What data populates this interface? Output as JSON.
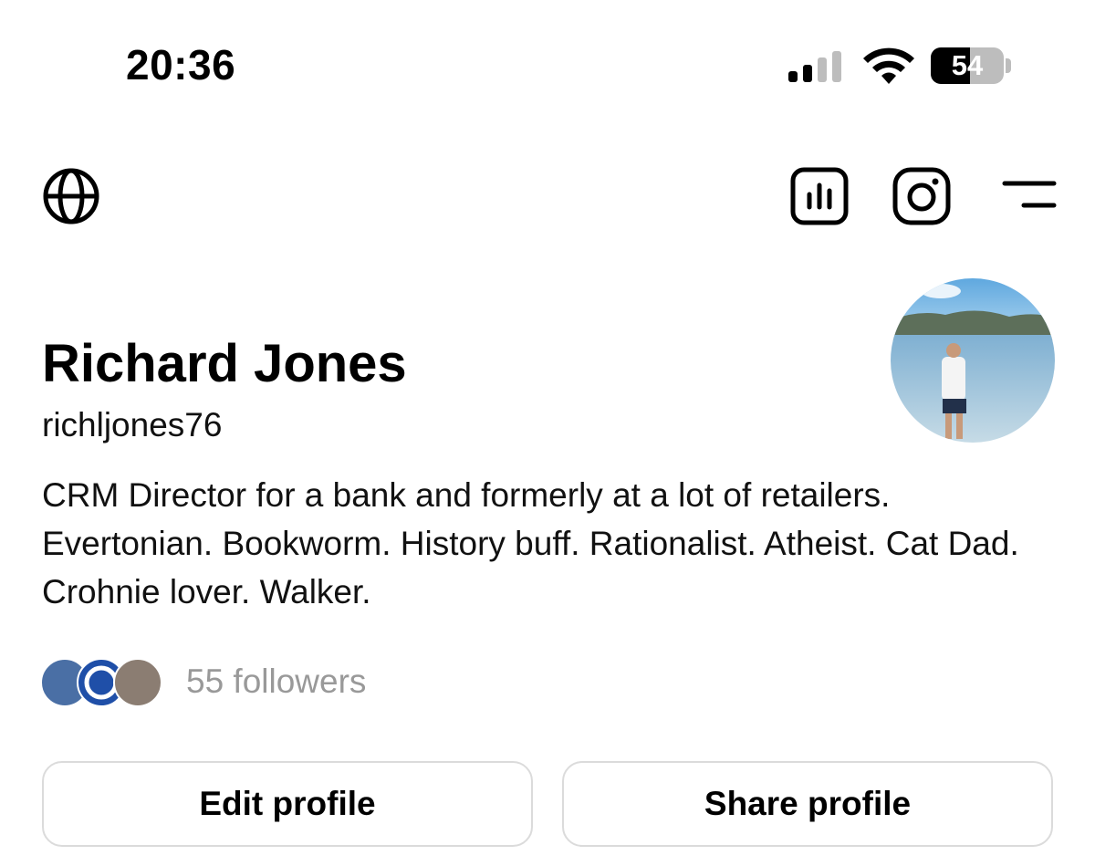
{
  "status_bar": {
    "time": "20:36",
    "battery_level": "54",
    "icons": [
      "cellular-signal-icon",
      "wifi-icon",
      "battery-icon"
    ]
  },
  "header": {
    "icons": [
      "globe-icon",
      "insights-icon",
      "instagram-icon",
      "menu-icon"
    ]
  },
  "profile": {
    "name": "Richard Jones",
    "username": "richljones76",
    "bio": "CRM Director for a bank and formerly at a lot of retailers. Evertonian. Bookworm. History buff. Rationalist. Atheist. Cat Dad. Crohnie lover. Walker.",
    "followers_label": "55 followers"
  },
  "actions": {
    "edit_label": "Edit profile",
    "share_label": "Share profile"
  }
}
